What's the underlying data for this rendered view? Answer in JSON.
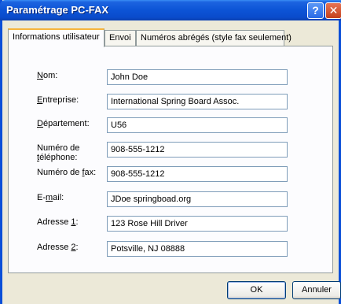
{
  "window": {
    "title": "Paramétrage PC-FAX",
    "help_glyph": "?",
    "close_glyph": "✕"
  },
  "tabs": [
    {
      "label": "Informations utilisateur",
      "active": true
    },
    {
      "label": "Envoi",
      "active": false
    },
    {
      "label": "Numéros abrégés (style fax seulement)",
      "active": false
    }
  ],
  "form": {
    "nom": {
      "label_pre": "",
      "label_key": "N",
      "label_post": "om:",
      "value": "John Doe"
    },
    "entreprise": {
      "label_pre": "",
      "label_key": "E",
      "label_post": "ntreprise:",
      "value": "International Spring Board Assoc."
    },
    "departement": {
      "label_pre": "",
      "label_key": "D",
      "label_post": "épartement:",
      "value": "U56"
    },
    "telephone": {
      "label_line1": "Numéro de",
      "label_pre": "",
      "label_key": "t",
      "label_post": "éléphone:",
      "value": "908-555-1212"
    },
    "fax": {
      "label_pre": "Numéro de ",
      "label_key": "f",
      "label_post": "ax:",
      "value": "908-555-1212"
    },
    "email": {
      "label_pre": "E-",
      "label_key": "m",
      "label_post": "ail:",
      "value": "JDoe springboad.org"
    },
    "adresse1": {
      "label_pre": "Adresse ",
      "label_key": "1",
      "label_post": ":",
      "value": "123 Rose Hill Driver"
    },
    "adresse2": {
      "label_pre": "Adresse ",
      "label_key": "2",
      "label_post": ":",
      "value": "Potsville, NJ 08888"
    }
  },
  "buttons": {
    "ok": "OK",
    "cancel": "Annuler"
  }
}
